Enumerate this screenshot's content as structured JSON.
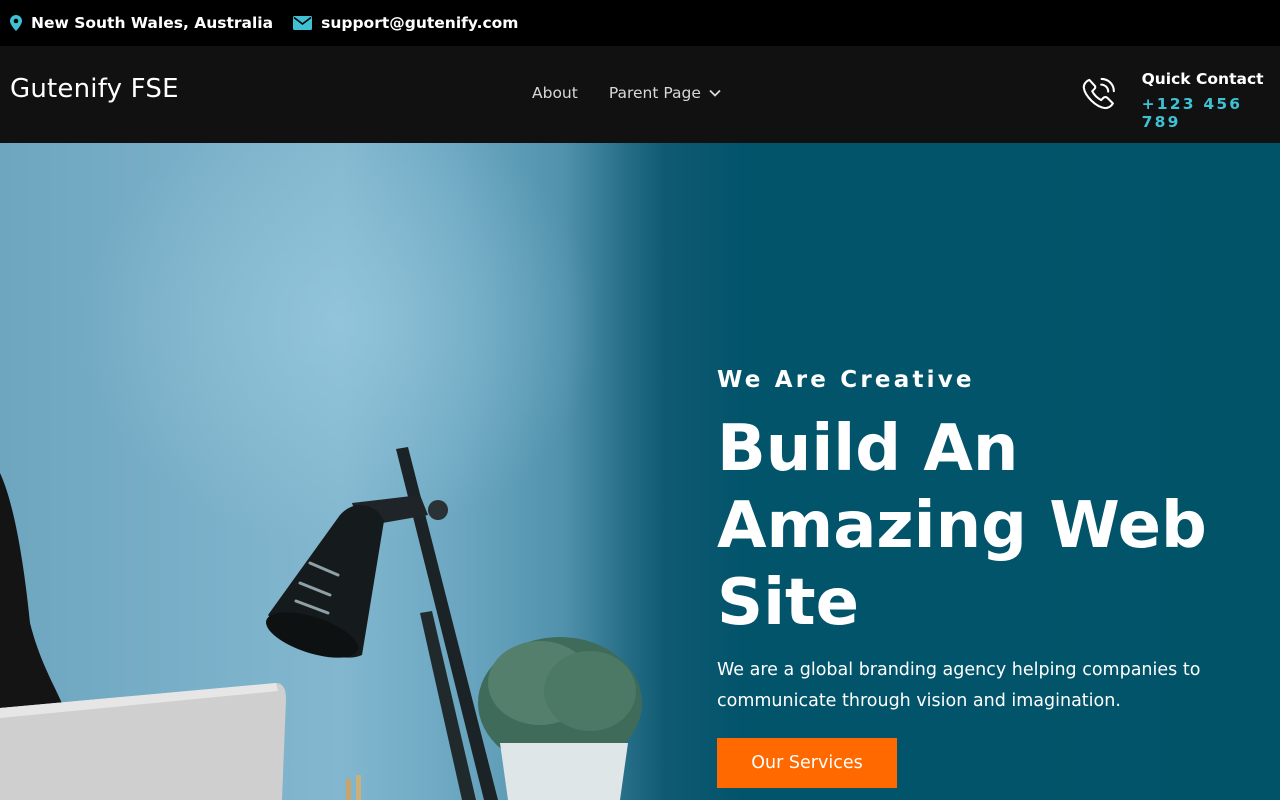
{
  "topbar": {
    "location": "New South Wales, Australia",
    "email": "support@gutenify.com",
    "location_icon": "map-pin-icon",
    "email_icon": "envelope-icon"
  },
  "header": {
    "site_title": "Gutenify FSE",
    "nav": [
      {
        "label": "About"
      },
      {
        "label": "Parent Page",
        "has_submenu": true
      }
    ],
    "contact": {
      "label": "Quick Contact",
      "phone": "+123 456 789",
      "icon": "phone-icon"
    }
  },
  "hero": {
    "eyebrow": "We Are Creative",
    "headline": "Build An Amazing Web Site",
    "description": "We are a global branding agency helping companies to communicate through vision and imagination.",
    "cta_label": "Our Services"
  },
  "colors": {
    "accent": "#3ec1d3",
    "cta": "#ff6900",
    "hero_bg": "#015468",
    "header_bg": "#111111",
    "topbar_bg": "#000000"
  }
}
